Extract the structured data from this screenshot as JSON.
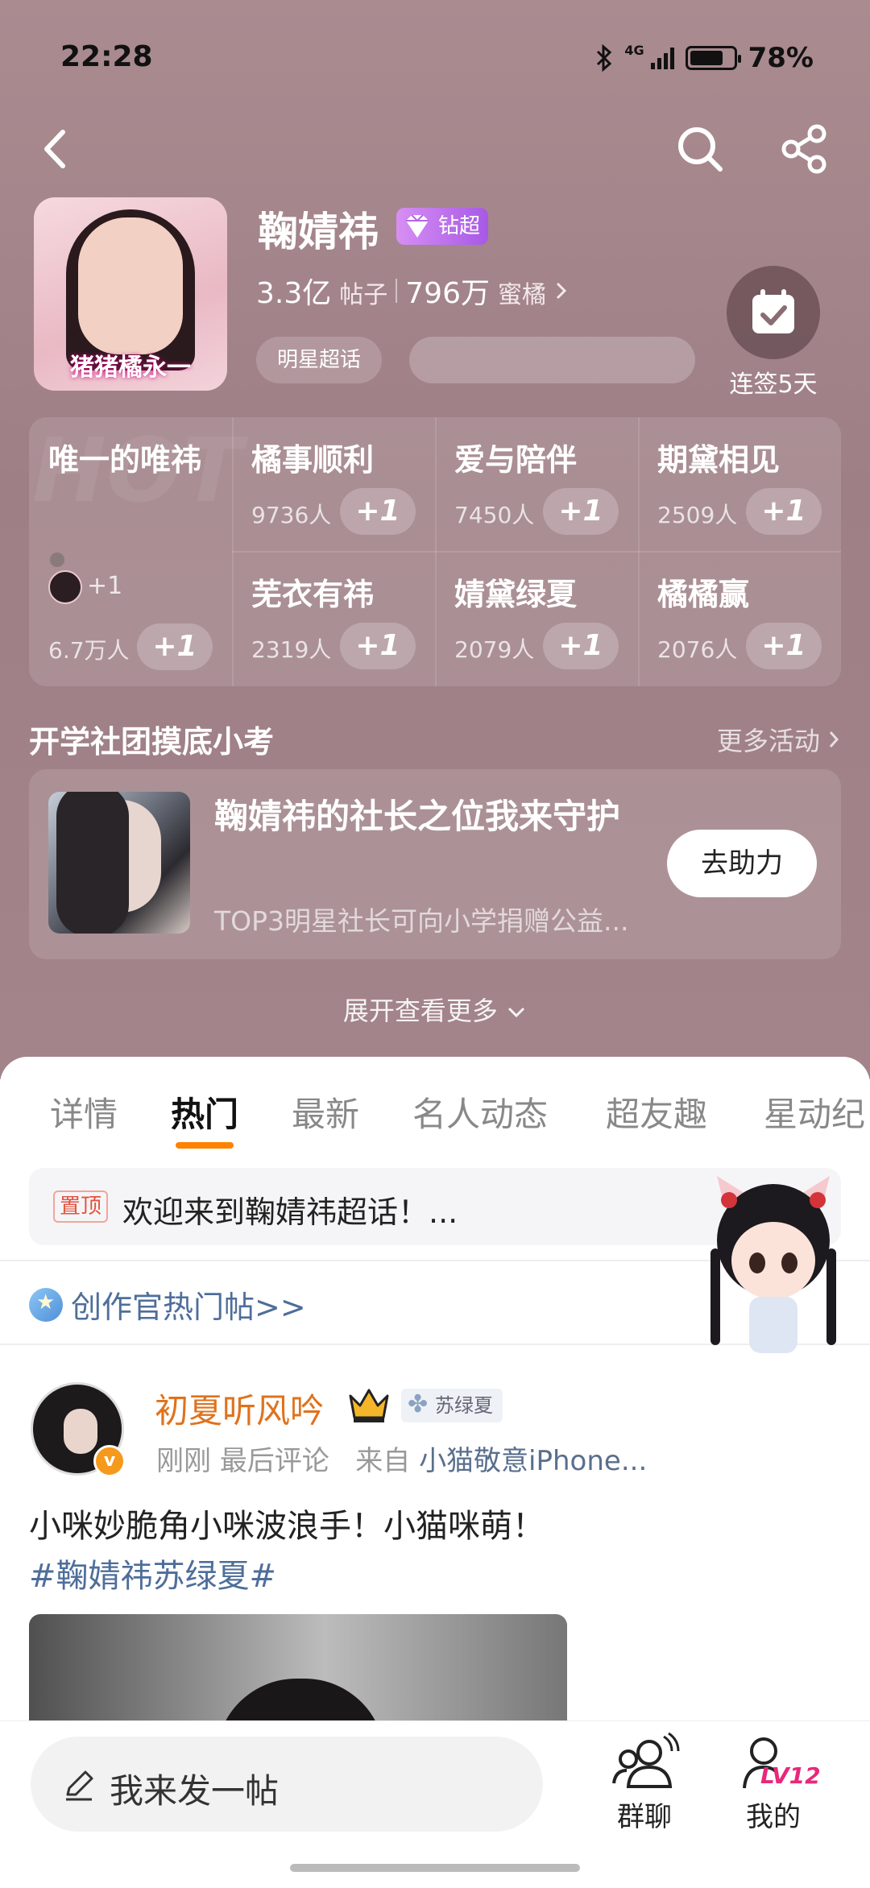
{
  "status": {
    "time": "22:28",
    "network": "4G",
    "battery": "78%"
  },
  "profile": {
    "name": "鞠婧祎",
    "badge": "钻超",
    "avatar_caption": "猪猪橘永一",
    "posts_value": "3.3亿",
    "posts_label": "帖子",
    "fans_value": "796万",
    "fans_label": "蜜橘",
    "category_tag": "明星超话",
    "checkin_label": "连签5天"
  },
  "hot": {
    "watermark": "HOT",
    "main": {
      "title": "唯一的唯祎",
      "count": "6.7万人",
      "mini_plus": "+1"
    },
    "plus_label": "+1",
    "cells": [
      {
        "title": "橘事顺利",
        "count": "9736人"
      },
      {
        "title": "爱与陪伴",
        "count": "7450人"
      },
      {
        "title": "期黛相见",
        "count": "2509人"
      },
      {
        "title": "芜衣有祎",
        "count": "2319人"
      },
      {
        "title": "婧黛绿夏",
        "count": "2079人"
      },
      {
        "title": "橘橘赢",
        "count": "2076人"
      }
    ]
  },
  "activity": {
    "section_title": "开学社团摸底小考",
    "more": "更多活动",
    "title": "鞠婧祎的社长之位我来守护",
    "subtitle": "TOP3明星社长可向小学捐赠公益...",
    "button": "去助力",
    "expand": "展开查看更多"
  },
  "tabs": [
    "详情",
    "热门",
    "最新",
    "名人动态",
    "超友趣",
    "星动纪"
  ],
  "active_tab": "热门",
  "pinned": {
    "tag": "置顶",
    "text": "欢迎来到鞠婧祎超话！..."
  },
  "creator_link": "创作官热门帖>>",
  "post": {
    "author": "初夏听风吟",
    "fan_tag": "苏绿夏",
    "time": "刚刚",
    "meta": "最后评论",
    "source_prefix": "来自",
    "source": "小猫敬意iPhone...",
    "text": "小咪妙脆角小咪波浪手！小猫咪萌！",
    "hashtag": "#鞠婧祎苏绿夏#"
  },
  "bottom": {
    "compose_placeholder": "我来发一帖",
    "group_label": "群聊",
    "me_label": "我的",
    "level": "LV12"
  },
  "colors": {
    "accent": "#ff8200",
    "author": "#e0721c",
    "link": "#4e6e9a",
    "level": "#e8287c"
  }
}
